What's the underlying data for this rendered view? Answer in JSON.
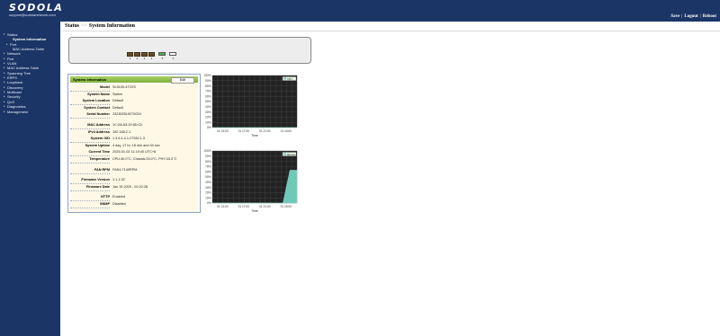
{
  "header": {
    "logo": "SODOLA",
    "email": "support@sodolanetwork.com",
    "links": [
      "Save",
      "Logout",
      "Reboot"
    ]
  },
  "sidebar": {
    "items": [
      {
        "label": "Status",
        "level": 0,
        "arrow": "▾"
      },
      {
        "label": "System Information",
        "level": 2,
        "active": true
      },
      {
        "label": "Port",
        "level": 1,
        "arrow": "▸"
      },
      {
        "label": "MAC Address Table",
        "level": 2
      },
      {
        "label": "Network",
        "level": 0,
        "arrow": "▸"
      },
      {
        "label": "Port",
        "level": 0,
        "arrow": "▸"
      },
      {
        "label": "VLAN",
        "level": 0,
        "arrow": "▸"
      },
      {
        "label": "MAC Address Table",
        "level": 0,
        "arrow": "▸"
      },
      {
        "label": "Spanning Tree",
        "level": 0,
        "arrow": "▸"
      },
      {
        "label": "ERPS",
        "level": 0,
        "arrow": "▸"
      },
      {
        "label": "Loopback",
        "level": 0,
        "arrow": "▸"
      },
      {
        "label": "Discovery",
        "level": 0,
        "arrow": "▸"
      },
      {
        "label": "Multicast",
        "level": 0,
        "arrow": "▸"
      },
      {
        "label": "Security",
        "level": 0,
        "arrow": "▸"
      },
      {
        "label": "QoS",
        "level": 0,
        "arrow": "▸"
      },
      {
        "label": "Diagnostics",
        "level": 0,
        "arrow": "▸"
      },
      {
        "label": "Management",
        "level": 0,
        "arrow": "▸"
      }
    ]
  },
  "breadcrumb": {
    "section": "Status",
    "separator": ">>",
    "page": "System Information"
  },
  "device": {
    "ports": [
      "1",
      "2",
      "3",
      "4"
    ],
    "sfp_ports": [
      "5",
      "6"
    ],
    "colors": {
      "port_active": "#4caf50",
      "port_body": "#6b4f2a"
    }
  },
  "info": {
    "title": "System Information",
    "edit_label": "Edit",
    "rows": [
      {
        "label": "Model",
        "value": "SL5100-4T2XS"
      },
      {
        "label": "System Name",
        "value": "Switch"
      },
      {
        "label": "System Location",
        "value": "Default"
      },
      {
        "label": "System Contact",
        "value": "Default"
      },
      {
        "label": "Serial Number",
        "value": "232302519270024"
      },
      {
        "label": "MAC Address",
        "value": "1C:2A:A3:19:8D:C0"
      },
      {
        "label": "IPv4 Address",
        "value": "192.168.2.1"
      },
      {
        "label": "System OID",
        "value": "1.3.6.1.4.1.27282.1.3"
      },
      {
        "label": "System Uptime",
        "value": "4 day, 17 hr, 18 min and 34 sec"
      },
      {
        "label": "Current Time",
        "value": "2025-01-02 11:19:40 UTC+8"
      },
      {
        "label": "Temperature",
        "value": "CPU:40.0°C, Chassis:33.0°C, PHY:33.0°C"
      },
      {
        "label": "FAN RPM",
        "value": "FAN1:7149RPM"
      },
      {
        "label": "Firmware Version",
        "value": "1.1.1.32"
      },
      {
        "label": "Firmware Date",
        "value": "Jan 15 2025 - 02:22:28"
      },
      {
        "label": "HTTP",
        "value": "Enabled"
      },
      {
        "label": "SNMP",
        "value": "Disabled"
      }
    ]
  },
  "chart_data": [
    {
      "type": "area",
      "legend": [
        "CPU"
      ],
      "y_ticks": [
        "100%",
        "90%",
        "80%",
        "70%",
        "60%",
        "50%",
        "40%",
        "30%",
        "20%",
        "10%",
        "0%"
      ],
      "ylim": [
        0,
        100
      ],
      "x": [
        "01 13:00",
        "01 17:00",
        "01 21:00",
        "01 15:00"
      ],
      "xlabel": "Time",
      "series": [
        {
          "name": "CPU",
          "values": [
            0,
            0,
            0,
            0,
            0,
            0
          ]
        }
      ],
      "grid": true,
      "colors": {
        "background": "#222222",
        "fill": "#6fc9b8"
      }
    },
    {
      "type": "area",
      "legend": [
        "Memory"
      ],
      "y_ticks": [
        "100%",
        "90%",
        "80%",
        "70%",
        "60%",
        "50%",
        "40%",
        "30%",
        "20%",
        "10%",
        "0%"
      ],
      "ylim": [
        0,
        100
      ],
      "x": [
        "01 13:00",
        "01 17:00",
        "01 21:00",
        "01 15:00"
      ],
      "xlabel": "Time",
      "series": [
        {
          "name": "Memory",
          "values": [
            0,
            0,
            0,
            0,
            0,
            0,
            0,
            0,
            0,
            0,
            0,
            63,
            63
          ]
        }
      ],
      "grid": true,
      "colors": {
        "background": "#222222",
        "fill": "#6fc9b8"
      }
    }
  ]
}
